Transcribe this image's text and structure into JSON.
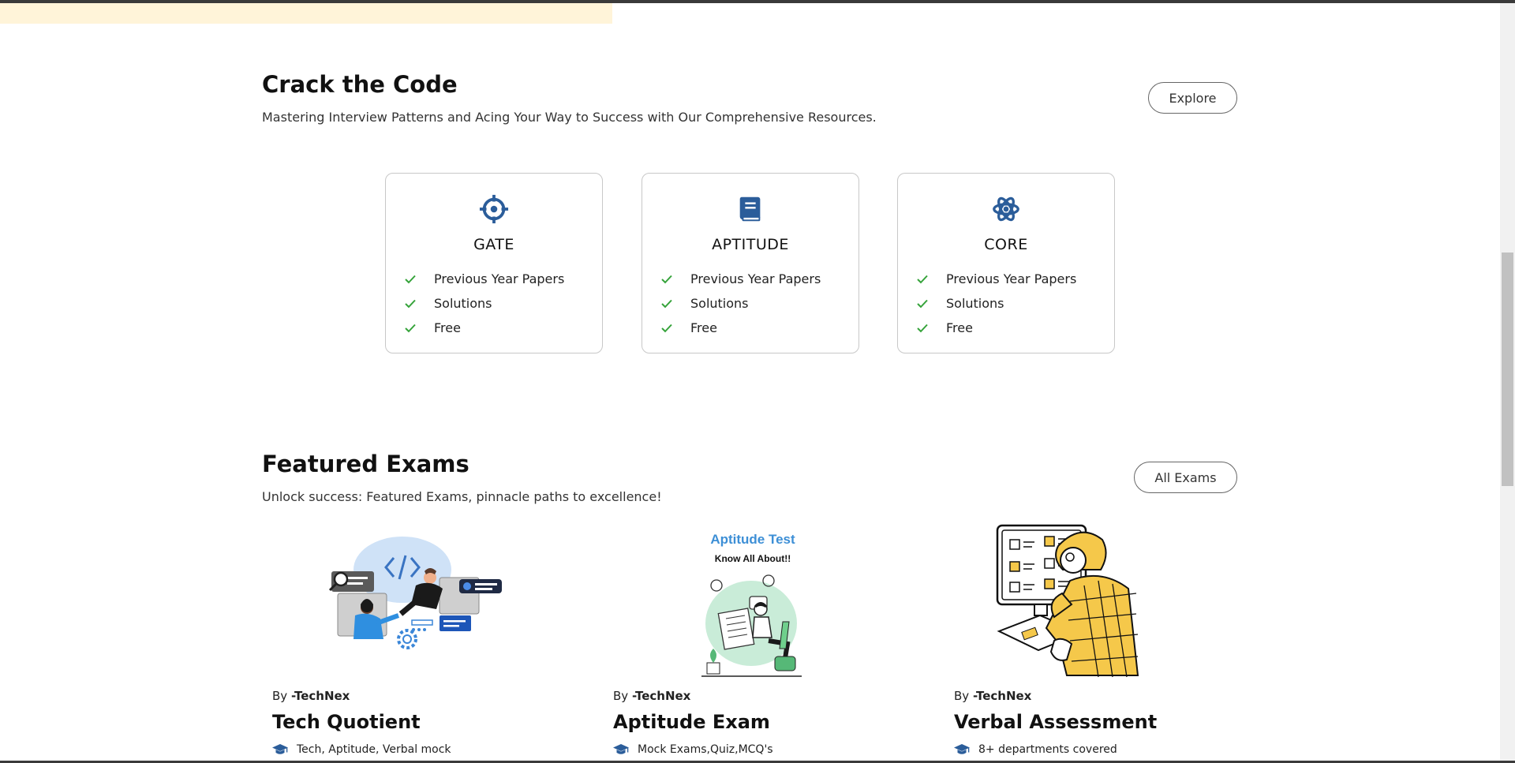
{
  "colors": {
    "accent_blue": "#2b5d9a",
    "check_green": "#35a33a",
    "banner": "#fff4d9"
  },
  "crack": {
    "title": "Crack the Code",
    "subtitle": "Mastering Interview Patterns and Acing Your Way to Success with Our Comprehensive Resources.",
    "button": "Explore",
    "cards": [
      {
        "title": "GATE",
        "icon": "crosshair-icon",
        "items": [
          "Previous Year Papers",
          "Solutions",
          "Free"
        ]
      },
      {
        "title": "APTITUDE",
        "icon": "book-icon",
        "items": [
          "Previous Year Papers",
          "Solutions",
          "Free"
        ]
      },
      {
        "title": "CORE",
        "icon": "atom-icon",
        "items": [
          "Previous Year Papers",
          "Solutions",
          "Free"
        ]
      }
    ]
  },
  "featured": {
    "title": "Featured Exams",
    "subtitle": "Unlock success: Featured Exams, pinnacle paths to excellence!",
    "button": "All Exams",
    "exams": [
      {
        "by_prefix": "By",
        "author": "-TechNex",
        "title": "Tech Quotient",
        "meta": "Tech, Aptitude, Verbal mock",
        "icon": "graduation-cap-icon"
      },
      {
        "by_prefix": "By",
        "author": "-TechNex",
        "title": "Aptitude Exam",
        "meta": "Mock Exams,Quiz,MCQ's",
        "icon": "graduation-cap-icon",
        "image_heading": "Aptitude Test",
        "image_sub": "Know All About!!"
      },
      {
        "by_prefix": "By",
        "author": "-TechNex",
        "title": "Verbal Assessment",
        "meta": "8+ departments covered",
        "icon": "graduation-cap-icon"
      }
    ]
  }
}
